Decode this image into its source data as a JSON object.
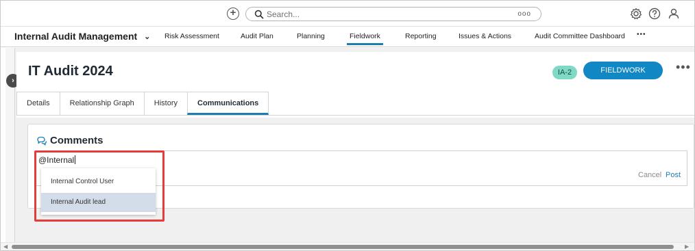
{
  "topbar": {
    "search_placeholder": "Search...",
    "search_more": "ooo",
    "icons": [
      "add-icon",
      "search-icon",
      "settings-gear-icon",
      "help-icon",
      "user-profile-icon"
    ]
  },
  "nav": {
    "app_name": "Internal Audit Management",
    "items": [
      {
        "label": "Risk Assessment"
      },
      {
        "label": "Audit Plan"
      },
      {
        "label": "Planning"
      },
      {
        "label": "Fieldwork"
      },
      {
        "label": "Reporting"
      },
      {
        "label": "Issues & Actions"
      },
      {
        "label": "Audit Committee Dashboard"
      }
    ],
    "active": "Fieldwork",
    "more": "•••"
  },
  "record": {
    "title": "IT Audit 2024",
    "id": "IA-2",
    "status": "FIELDWORK",
    "more": "•••"
  },
  "tabs": [
    {
      "label": "Details"
    },
    {
      "label": "Relationship Graph"
    },
    {
      "label": "History"
    },
    {
      "label": "Communications"
    }
  ],
  "active_tab": "Communications",
  "comments": {
    "title": "Comments",
    "input_value": "@Internal",
    "cancel_label": "Cancel",
    "post_label": "Post"
  },
  "mention_suggestions": [
    {
      "label": "Internal Control User"
    },
    {
      "label": "Internal Audit lead"
    }
  ],
  "colors": {
    "accent": "#1b7db1",
    "status_pill": "#1188c4",
    "id_badge": "#7fd9c4",
    "highlight": "#e63b3b",
    "selected_suggestion": "#d3ddea"
  }
}
